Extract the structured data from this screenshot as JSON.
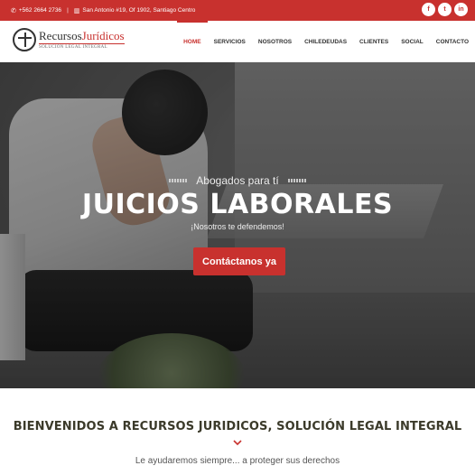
{
  "topbar": {
    "phone": "+562 2664 2736",
    "address": "San Antonio #19, Of 1902, Santiago Centro",
    "social": {
      "facebook": "f",
      "twitter": "t",
      "linkedin": "in"
    },
    "icons": {
      "phone": "phone-icon",
      "building": "building-icon",
      "facebook": "facebook-icon",
      "twitter": "twitter-icon",
      "linkedin": "linkedin-icon"
    },
    "accent_color": "#c8312e"
  },
  "logo": {
    "name_part1": "Recursos",
    "name_part2": "Jurídicos",
    "tagline": "SOLUCIÓN LEGAL INTEGRAL"
  },
  "nav": {
    "items": [
      {
        "label": "HOME",
        "active": true
      },
      {
        "label": "SERVICIOS"
      },
      {
        "label": "NOSOTROS"
      },
      {
        "label": "CHILEDEUDAS"
      },
      {
        "label": "CLIENTES"
      },
      {
        "label": "SOCIAL"
      },
      {
        "label": "CONTACTO"
      }
    ]
  },
  "hero": {
    "subtitle": "Abogados para tí",
    "title": "JUICIOS LABORALES",
    "tagline": "¡Nosotros te defendemos!",
    "cta_label": "Contáctanos ya"
  },
  "welcome": {
    "heading": "BIENVENIDOS A RECURSOS JURIDICOS, SOLUCIÓN LEGAL INTEGRAL",
    "subheading": "Le ayudaremos siempre... a proteger sus derechos",
    "chevron_icon": "chevron-down-icon"
  }
}
